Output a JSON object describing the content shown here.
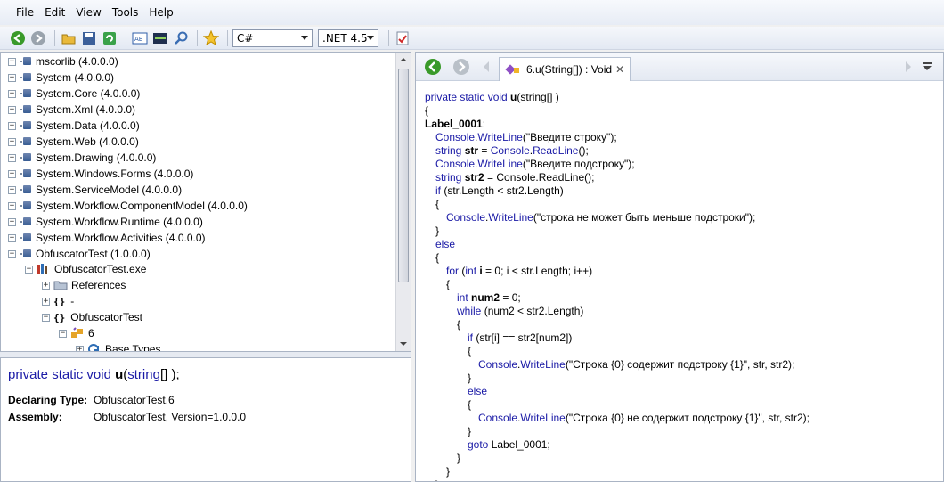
{
  "menu": [
    "File",
    "Edit",
    "View",
    "Tools",
    "Help"
  ],
  "toolbar": {
    "language": "C#",
    "framework": ".NET 4.5",
    "icons": [
      "back-icon",
      "forward-icon",
      "open-icon",
      "save-icon",
      "refresh-icon",
      "decompile-icon",
      "il-icon",
      "search-icon",
      "favorite-icon",
      "report-icon"
    ]
  },
  "tree": {
    "assemblies": [
      {
        "label": "mscorlib (4.0.0.0)"
      },
      {
        "label": "System (4.0.0.0)"
      },
      {
        "label": "System.Core (4.0.0.0)"
      },
      {
        "label": "System.Xml (4.0.0.0)"
      },
      {
        "label": "System.Data (4.0.0.0)"
      },
      {
        "label": "System.Web (4.0.0.0)"
      },
      {
        "label": "System.Drawing (4.0.0.0)"
      },
      {
        "label": "System.Windows.Forms (4.0.0.0)"
      },
      {
        "label": "System.ServiceModel (4.0.0.0)"
      },
      {
        "label": "System.Workflow.ComponentModel (4.0.0.0)"
      },
      {
        "label": "System.Workflow.Runtime (4.0.0.0)"
      },
      {
        "label": "System.Workflow.Activities (4.0.0.0)"
      },
      {
        "label": "ObfuscatorTest (1.0.0.0)"
      }
    ],
    "module": "ObfuscatorTest.exe",
    "references": "References",
    "namespace_empty": "-",
    "namespace": "ObfuscatorTest",
    "class": "6",
    "base_types": "Base Types"
  },
  "info": {
    "signature": {
      "kw1": "private",
      "kw2": "static",
      "kw3": "void",
      "name": "u",
      "paramType": "string",
      "rest": "[] );"
    },
    "declaring_type_label": "Declaring Type:",
    "declaring_type": "ObfuscatorTest.6",
    "assembly_label": "Assembly:",
    "assembly": "ObfuscatorTest, Version=1.0.0.0"
  },
  "code_tab": {
    "title": "6.u(String[]) : Void",
    "close": "✕"
  },
  "code_lines": [
    {
      "indent": 0,
      "tokens": [
        [
          "kw",
          "private static void "
        ],
        [
          "bold",
          "u"
        ],
        [
          "",
          "(string[] )"
        ]
      ]
    },
    {
      "indent": 0,
      "tokens": [
        [
          "",
          "{"
        ]
      ]
    },
    {
      "indent": 0,
      "tokens": [
        [
          "bold",
          "Label_0001"
        ],
        [
          "",
          ":"
        ]
      ]
    },
    {
      "indent": 1,
      "tokens": [
        [
          "kw",
          "Console"
        ],
        [
          "",
          "."
        ],
        [
          "kw",
          "WriteLine"
        ],
        [
          "",
          "(\"Введите строку\");"
        ]
      ]
    },
    {
      "indent": 1,
      "tokens": [
        [
          "kw",
          "string "
        ],
        [
          "bold",
          "str"
        ],
        [
          "",
          " = "
        ],
        [
          "kw",
          "Console"
        ],
        [
          "",
          "."
        ],
        [
          "kw",
          "ReadLine"
        ],
        [
          "",
          "();"
        ]
      ]
    },
    {
      "indent": 1,
      "tokens": [
        [
          "kw",
          "Console"
        ],
        [
          "",
          "."
        ],
        [
          "kw",
          "WriteLine"
        ],
        [
          "",
          "(\"Введите подстроку\");"
        ]
      ]
    },
    {
      "indent": 1,
      "tokens": [
        [
          "kw",
          "string "
        ],
        [
          "bold",
          "str2"
        ],
        [
          "",
          ""
        ],
        [
          "",
          ""
        ],
        [
          "",
          ""
        ],
        [
          "",
          ""
        ],
        [
          "",
          ""
        ]
      ]
    },
    {
      "indent": 1,
      "tokens": [
        [
          "kw",
          "if"
        ],
        [
          "",
          " (str.Length < str2.Length)"
        ]
      ]
    },
    {
      "indent": 1,
      "tokens": [
        [
          "",
          "{"
        ]
      ]
    },
    {
      "indent": 2,
      "tokens": [
        [
          "kw",
          "Console"
        ],
        [
          "",
          "."
        ],
        [
          "kw",
          "WriteLine"
        ],
        [
          "",
          "(\"строка не может быть меньше подстроки\");"
        ]
      ]
    },
    {
      "indent": 1,
      "tokens": [
        [
          "",
          "}"
        ]
      ]
    },
    {
      "indent": 1,
      "tokens": [
        [
          "kw",
          "else"
        ]
      ]
    },
    {
      "indent": 1,
      "tokens": [
        [
          "",
          "{"
        ]
      ]
    },
    {
      "indent": 2,
      "tokens": [
        [
          "kw",
          "for"
        ],
        [
          "",
          " ("
        ],
        [
          "kw",
          "int "
        ],
        [
          "bold",
          "i"
        ],
        [
          "",
          ""
        ],
        [
          "",
          " = 0; i < str.Length; i++)"
        ]
      ]
    },
    {
      "indent": 2,
      "tokens": [
        [
          "",
          "{"
        ]
      ]
    },
    {
      "indent": 3,
      "tokens": [
        [
          "kw",
          "int "
        ],
        [
          "bold",
          "num2"
        ],
        [
          "",
          " = 0;"
        ]
      ]
    },
    {
      "indent": 3,
      "tokens": [
        [
          "kw",
          "while"
        ],
        [
          "",
          " (num2 < str2.Length)"
        ]
      ]
    },
    {
      "indent": 3,
      "tokens": [
        [
          "",
          "{"
        ]
      ]
    },
    {
      "indent": 4,
      "tokens": [
        [
          "kw",
          "if"
        ],
        [
          "",
          " (str[i] == str2[num2])"
        ]
      ]
    },
    {
      "indent": 4,
      "tokens": [
        [
          "",
          "{"
        ]
      ]
    },
    {
      "indent": 5,
      "tokens": [
        [
          "kw",
          "Console"
        ],
        [
          "",
          "."
        ],
        [
          "kw",
          "WriteLine"
        ],
        [
          "",
          "(\"Строка {0} содержит подстроку {1}\", str, str2);"
        ]
      ]
    },
    {
      "indent": 4,
      "tokens": [
        [
          "",
          "}"
        ]
      ]
    },
    {
      "indent": 4,
      "tokens": [
        [
          "kw",
          "else"
        ]
      ]
    },
    {
      "indent": 4,
      "tokens": [
        [
          "",
          "{"
        ]
      ]
    },
    {
      "indent": 5,
      "tokens": [
        [
          "kw",
          "Console"
        ],
        [
          "",
          "."
        ],
        [
          "kw",
          "WriteLine"
        ],
        [
          "",
          "(\"Строка {0} не содержит подстроку {1}\", str, str2);"
        ]
      ]
    },
    {
      "indent": 4,
      "tokens": [
        [
          "",
          "}"
        ]
      ]
    },
    {
      "indent": 4,
      "tokens": [
        [
          "kw",
          "goto"
        ],
        [
          "",
          " Label_0001;"
        ]
      ]
    },
    {
      "indent": 3,
      "tokens": [
        [
          "",
          "}"
        ]
      ]
    },
    {
      "indent": 2,
      "tokens": [
        [
          "",
          "}"
        ]
      ]
    },
    {
      "indent": 1,
      "tokens": [
        [
          "",
          "}"
        ]
      ]
    }
  ],
  "code_line7_tail": " = Console.ReadLine();"
}
